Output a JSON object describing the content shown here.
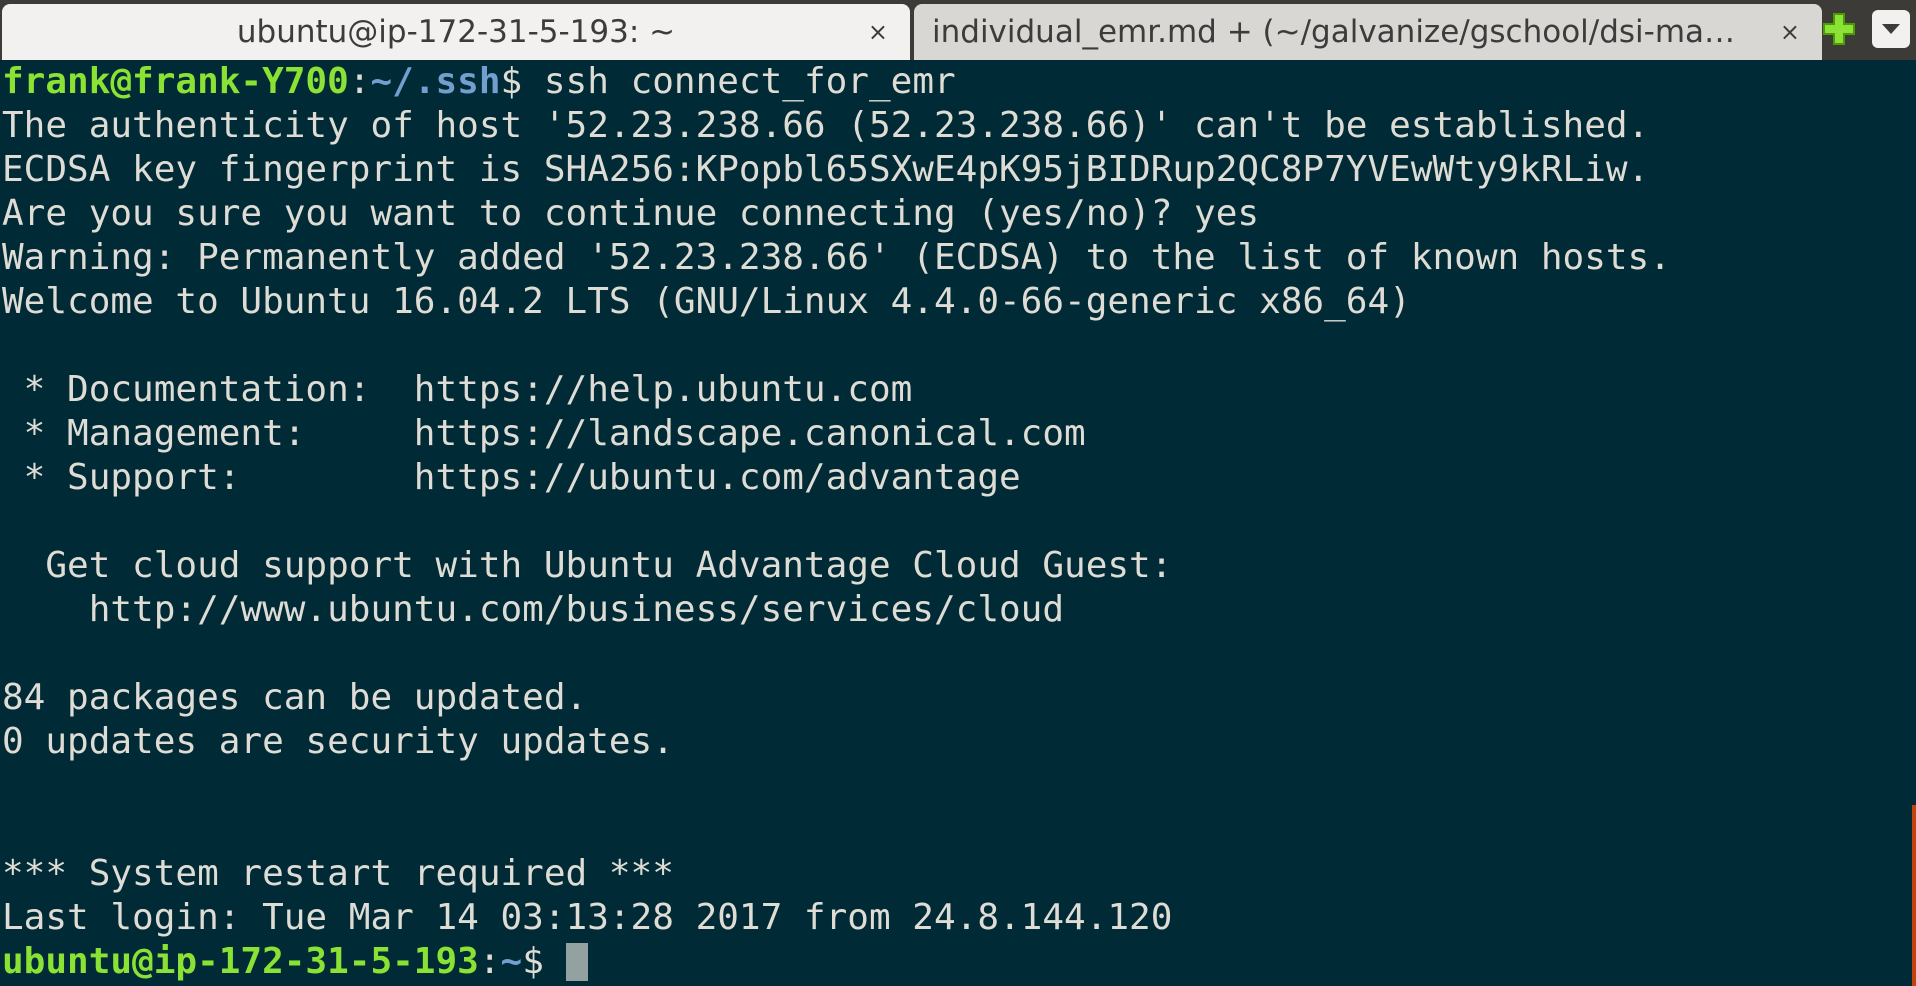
{
  "tabs": [
    {
      "title": "ubuntu@ip-172-31-5-193: ~",
      "close": "×"
    },
    {
      "title": "individual_emr.md + (~/galvanize/gschool/dsi-ma…",
      "close": "×"
    }
  ],
  "tab_controls": {
    "new_tab_icon": "plus-icon",
    "menu_icon": "chevron-down-icon"
  },
  "terminal": {
    "prompt1": {
      "user": "frank@frank-Y700",
      "sep": ":",
      "path": "~/.ssh",
      "symbol": "$",
      "command": " ssh connect_for_emr"
    },
    "output": [
      "The authenticity of host '52.23.238.66 (52.23.238.66)' can't be established.",
      "ECDSA key fingerprint is SHA256:KPopbl65SXwE4pK95jBIDRup2QC8P7YVEwWty9kRLiw.",
      "Are you sure you want to continue connecting (yes/no)? yes",
      "Warning: Permanently added '52.23.238.66' (ECDSA) to the list of known hosts.",
      "Welcome to Ubuntu 16.04.2 LTS (GNU/Linux 4.4.0-66-generic x86_64)",
      "",
      " * Documentation:  https://help.ubuntu.com",
      " * Management:     https://landscape.canonical.com",
      " * Support:        https://ubuntu.com/advantage",
      "",
      "  Get cloud support with Ubuntu Advantage Cloud Guest:",
      "    http://www.ubuntu.com/business/services/cloud",
      "",
      "84 packages can be updated.",
      "0 updates are security updates.",
      "",
      "",
      "*** System restart required ***",
      "Last login: Tue Mar 14 03:13:28 2017 from 24.8.144.120"
    ],
    "prompt2": {
      "user": "ubuntu@ip-172-31-5-193",
      "sep": ":",
      "path": "~",
      "symbol": "$ "
    }
  },
  "colors": {
    "background": "#002b36",
    "text": "#dedcd4",
    "prompt_user": "#8ae234",
    "prompt_path": "#729fcf",
    "scrollbar": "#c1440e"
  }
}
